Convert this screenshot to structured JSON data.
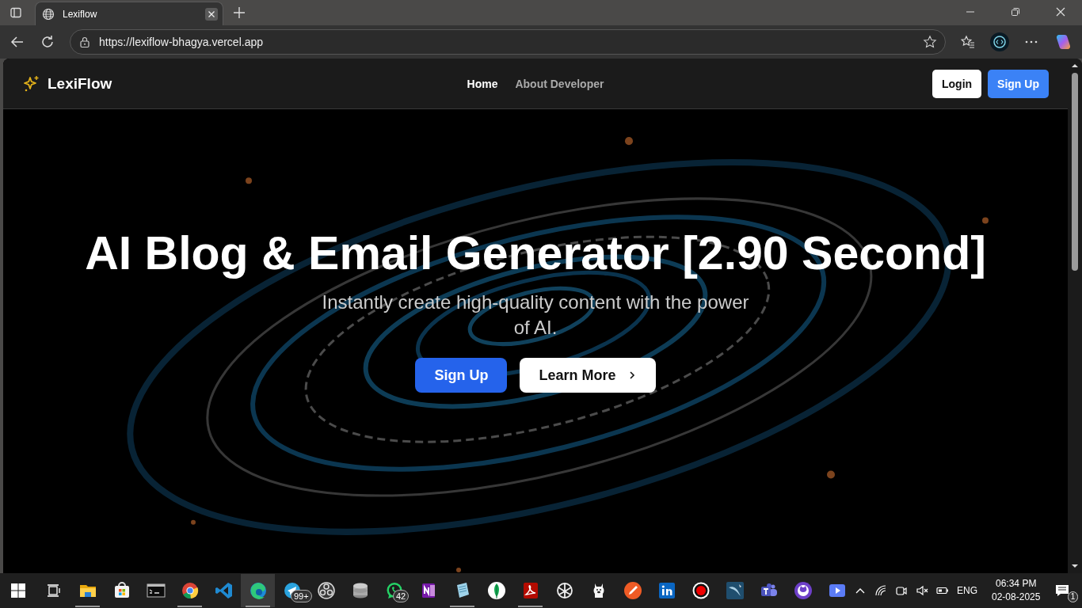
{
  "browser": {
    "tab": {
      "title": "Lexiflow"
    },
    "address": "https://lexiflow-bhagya.vercel.app"
  },
  "nav": {
    "logo": "LexiFlow",
    "links": [
      {
        "label": "Home",
        "selected": true
      },
      {
        "label": "About Developer",
        "selected": false
      }
    ],
    "login": "Login",
    "signup": "Sign Up"
  },
  "hero": {
    "title": "AI Blog & Email Generator [2.90 Second]",
    "subtitle": "Instantly create high-quality content with the power of AI.",
    "primary": "Sign Up",
    "secondary": "Learn More"
  },
  "taskbar": {
    "apps": [
      {
        "running": true,
        "selected": false
      },
      {
        "running": false,
        "selected": false
      },
      {
        "running": false,
        "selected": false
      },
      {
        "running": true,
        "selected": false
      },
      {
        "running": false,
        "selected": false
      },
      {
        "running": true,
        "selected": true
      },
      {
        "running": false,
        "selected": false,
        "badge": "99+"
      },
      {
        "running": false,
        "selected": false
      },
      {
        "running": false,
        "selected": false
      },
      {
        "running": false,
        "selected": false,
        "badge": "42"
      },
      {
        "running": false,
        "selected": false
      },
      {
        "running": true,
        "selected": false
      },
      {
        "running": false,
        "selected": false
      },
      {
        "running": true,
        "selected": false
      },
      {
        "running": false,
        "selected": false
      },
      {
        "running": false,
        "selected": false
      },
      {
        "running": false,
        "selected": false
      },
      {
        "running": false,
        "selected": false
      },
      {
        "running": false,
        "selected": false
      },
      {
        "running": false,
        "selected": false
      },
      {
        "running": false,
        "selected": false
      },
      {
        "running": false,
        "selected": false
      },
      {
        "running": false,
        "selected": false
      }
    ],
    "tray": {
      "language": "ENG",
      "time": "06:34 PM",
      "date": "02-08-2025",
      "notifications": "1"
    }
  }
}
